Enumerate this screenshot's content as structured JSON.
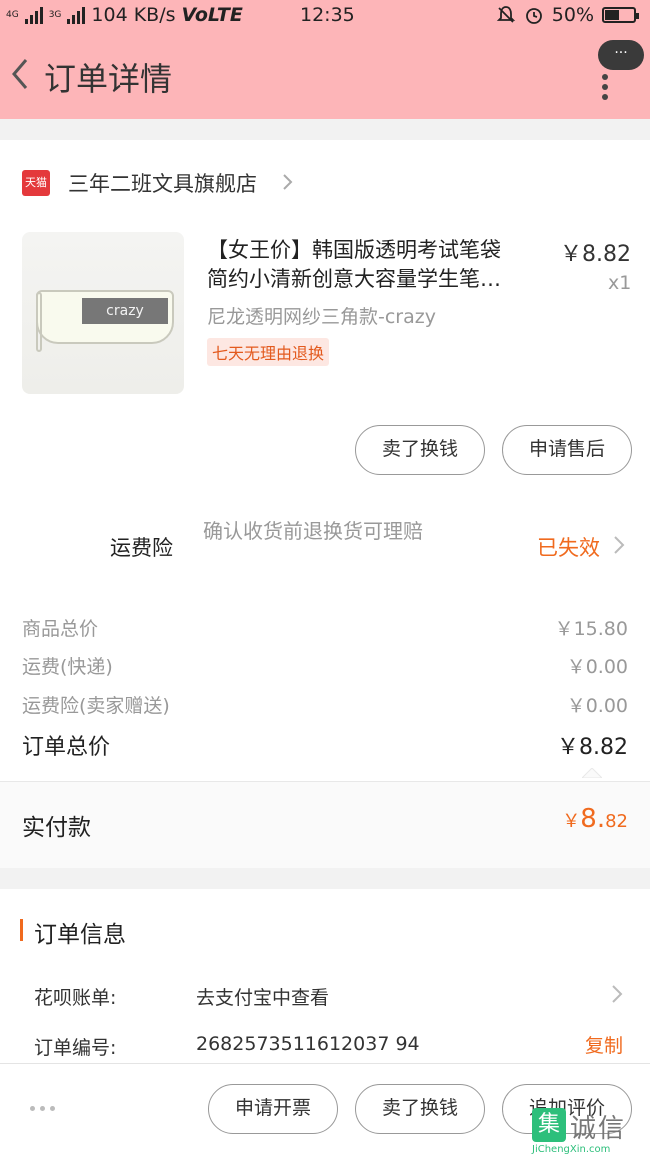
{
  "status_bar": {
    "net_left": "4G",
    "net_left2": "3G",
    "speed": "104 KB/s",
    "volte": "VoLTE",
    "time": "12:35",
    "battery": "50%",
    "battery_level": 0.5
  },
  "header": {
    "title": "订单详情",
    "more_label": "···"
  },
  "shop": {
    "badge": "天猫",
    "name": "三年二班文具旗舰店"
  },
  "product": {
    "image_text": "crazy",
    "title_line1": "【女王价】韩国版透明考试笔袋",
    "title_line2": "简约小清新创意大容量学生笔…",
    "price": "￥8.82",
    "qty": "x1",
    "sku": "尼龙透明网纱三角款-crazy",
    "tag": "七天无理由退换",
    "buttons": [
      "卖了换钱",
      "申请售后"
    ]
  },
  "insurance": {
    "label": "运费险",
    "desc": "确认收货前退换货可理赔",
    "status": "已失效"
  },
  "summary": [
    {
      "label": "商品总价",
      "value": "￥15.80"
    },
    {
      "label": "运费(快递)",
      "value": "￥0.00"
    },
    {
      "label": "运费险(卖家赠送)",
      "value": "￥0.00"
    }
  ],
  "order_total": {
    "label": "订单总价",
    "value": "￥8.82"
  },
  "paid": {
    "label": "实付款",
    "currency": "￥",
    "int": "8.",
    "dec": "82"
  },
  "order_info": {
    "title": "订单信息",
    "rows": [
      {
        "label": "花呗账单:",
        "value": "去支付宝中查看"
      },
      {
        "label": "订单编号:",
        "value": "2682573511612037 94"
      }
    ],
    "copy": "复制"
  },
  "bottom_bar": {
    "buttons": [
      "申请开票",
      "卖了换钱",
      "追加评价"
    ]
  },
  "watermark": {
    "box": "集",
    "cn": "诚信",
    "en": "JiChengXin.com"
  },
  "colors": {
    "header_bg": "#fdb5b8",
    "accent": "#f06a1e",
    "tmall_red": "#e4393c"
  }
}
